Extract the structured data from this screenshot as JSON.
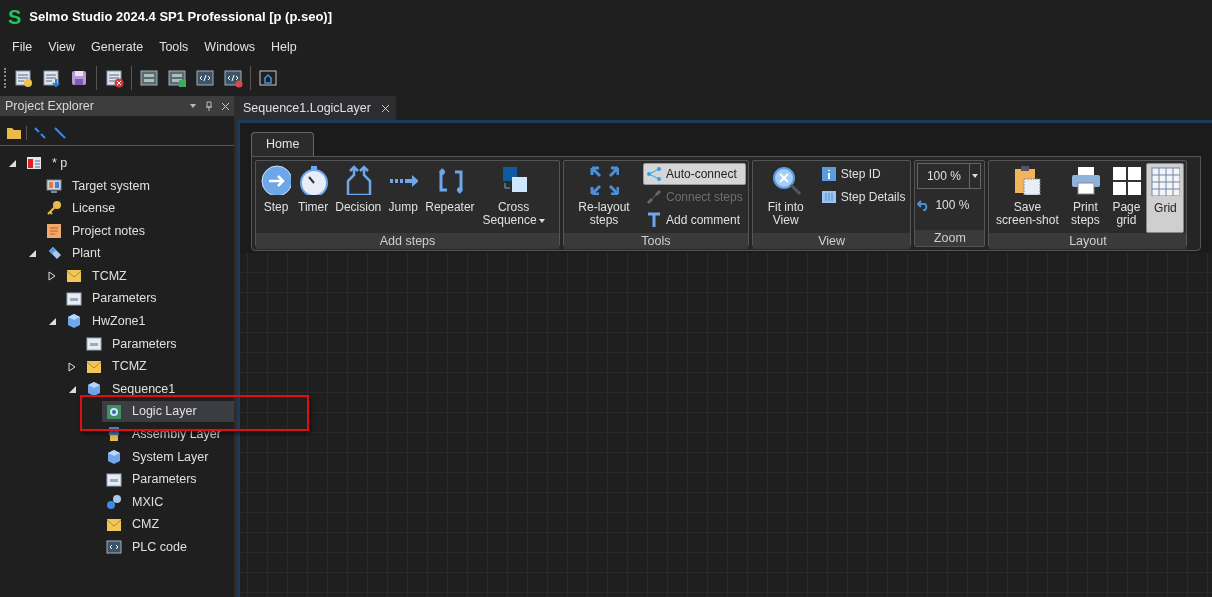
{
  "window": {
    "logo": "S",
    "title": "Selmo Studio 2024.4 SP1 Professional  [p (p.seo)]"
  },
  "menu": [
    "File",
    "View",
    "Generate",
    "Tools",
    "Windows",
    "Help"
  ],
  "explorer": {
    "title": "Project Explorer",
    "tree": [
      {
        "label": "* p",
        "kind": "project",
        "expanded": true,
        "selected": false,
        "children": [
          {
            "label": "Target system",
            "kind": "target",
            "selected": false
          },
          {
            "label": "License",
            "kind": "key",
            "selected": false
          },
          {
            "label": "Project notes",
            "kind": "notes",
            "selected": false
          },
          {
            "label": "Plant",
            "kind": "plant",
            "expanded": true,
            "selected": false,
            "children": [
              {
                "label": "TCMZ",
                "kind": "folder",
                "expanded": false,
                "selected": false
              },
              {
                "label": "Parameters",
                "kind": "params",
                "selected": false
              },
              {
                "label": "HwZone1",
                "kind": "cube",
                "expanded": true,
                "selected": false,
                "children": [
                  {
                    "label": "Parameters",
                    "kind": "params",
                    "selected": false
                  },
                  {
                    "label": "TCMZ",
                    "kind": "folder",
                    "expanded": false,
                    "selected": false
                  },
                  {
                    "label": "Sequence1",
                    "kind": "cube",
                    "expanded": true,
                    "selected": false,
                    "children": [
                      {
                        "label": "Logic Layer",
                        "kind": "logic",
                        "selected": true
                      },
                      {
                        "label": "Assembly Layer",
                        "kind": "assembly",
                        "selected": false
                      },
                      {
                        "label": "System Layer",
                        "kind": "cube",
                        "selected": false
                      },
                      {
                        "label": "Parameters",
                        "kind": "params",
                        "selected": false
                      },
                      {
                        "label": "MXIC",
                        "kind": "link",
                        "selected": false
                      },
                      {
                        "label": "CMZ",
                        "kind": "folder",
                        "selected": false
                      },
                      {
                        "label": "PLC code",
                        "kind": "code",
                        "selected": false
                      }
                    ]
                  }
                ]
              }
            ]
          }
        ]
      }
    ]
  },
  "document_tab": {
    "label": "Sequence1.LogicLayer",
    "selected": true
  },
  "ribbon": {
    "tabs": [
      {
        "label": "Home",
        "selected": true
      }
    ],
    "groups": [
      {
        "label": "Add steps",
        "items": [
          {
            "kind": "large",
            "label": "Step"
          },
          {
            "kind": "large",
            "label": "Timer"
          },
          {
            "kind": "large",
            "label": "Decision"
          },
          {
            "kind": "large",
            "label": "Jump"
          },
          {
            "kind": "large",
            "label": "Repeater"
          },
          {
            "kind": "large",
            "label": "Cross Sequence",
            "dropdown": true
          }
        ]
      },
      {
        "label": "Tools",
        "items": [
          {
            "kind": "large",
            "label": "Re-layout steps"
          },
          {
            "kind": "small",
            "label": "Auto-connect",
            "on": true,
            "disabled": false
          },
          {
            "kind": "small",
            "label": "Connect steps",
            "on": false,
            "disabled": true
          },
          {
            "kind": "small",
            "label": "Add comment",
            "on": false,
            "disabled": false
          }
        ]
      },
      {
        "label": "View",
        "items": [
          {
            "kind": "large",
            "label": "Fit into View"
          },
          {
            "kind": "small",
            "label": "Step ID",
            "on": false,
            "disabled": false
          },
          {
            "kind": "small",
            "label": "Step Details",
            "on": false,
            "disabled": false
          }
        ]
      },
      {
        "label": "Zoom",
        "items": [
          {
            "kind": "zoom",
            "value": "100 %",
            "reset": "100 %"
          }
        ]
      },
      {
        "label": "Layout",
        "items": [
          {
            "kind": "large",
            "label": "Save screen-shot",
            "on": false
          },
          {
            "kind": "large",
            "label": "Print steps",
            "on": false
          },
          {
            "kind": "large",
            "label": "Page grid",
            "on": false
          },
          {
            "kind": "large",
            "label": "Grid",
            "on": true
          }
        ]
      }
    ]
  }
}
